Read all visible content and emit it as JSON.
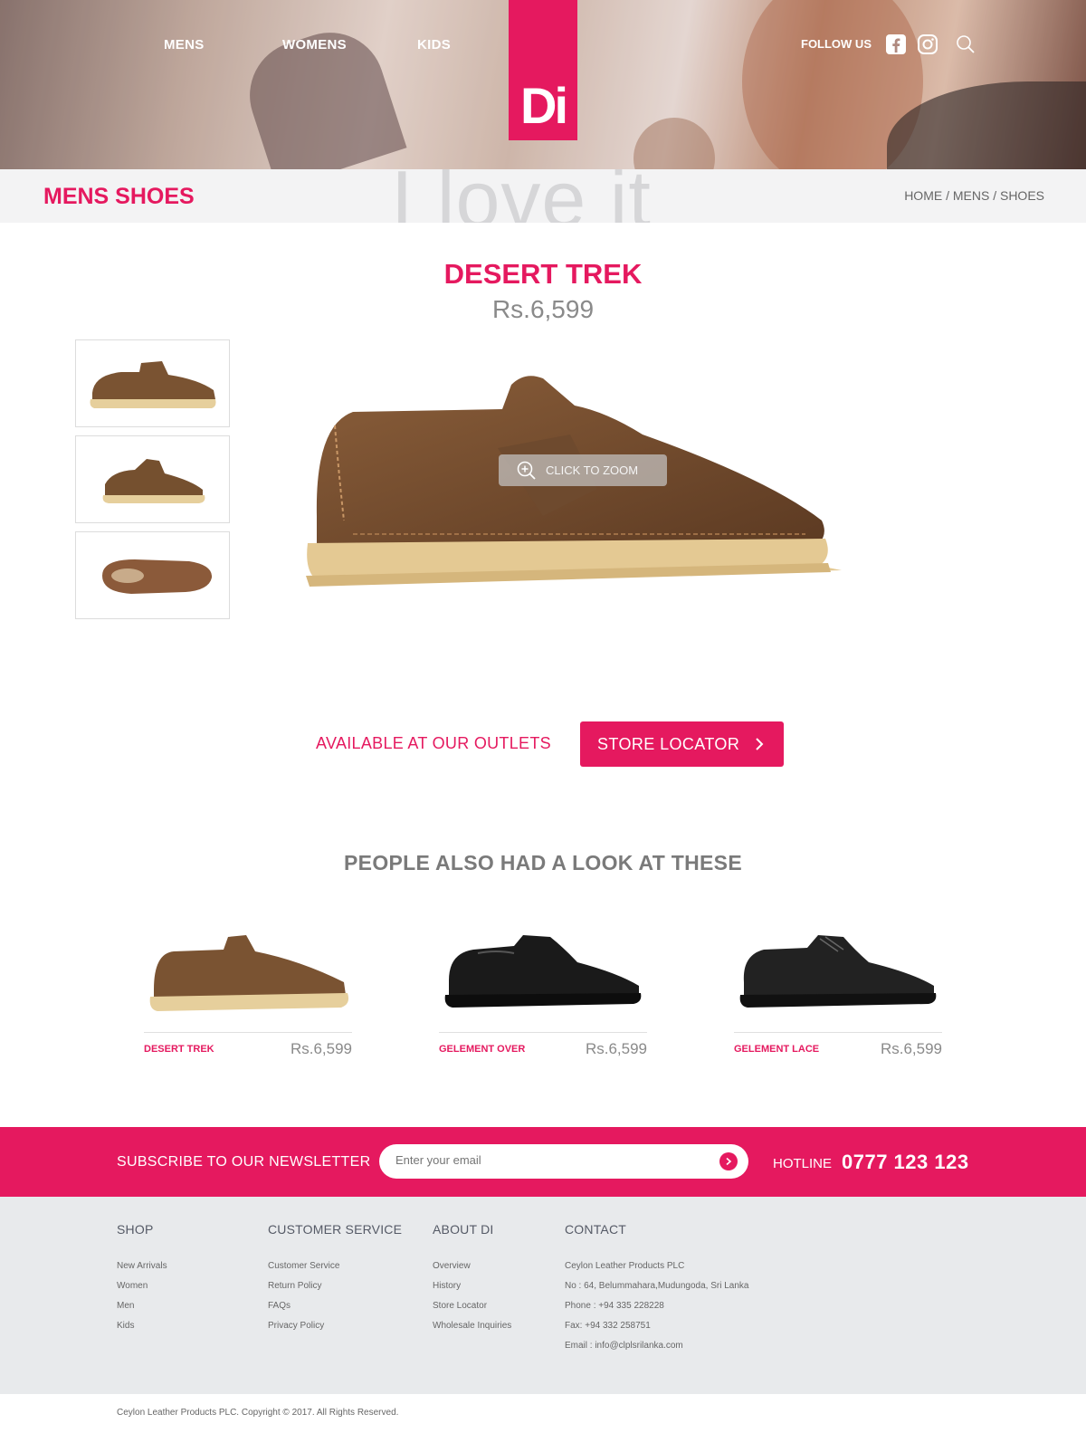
{
  "nav": {
    "mens": "MENS",
    "womens": "WOMENS",
    "kids": "KIDS"
  },
  "logo": "Di",
  "follow": "FOLLOW US",
  "icons": {
    "facebook": "facebook-icon",
    "instagram": "instagram-icon",
    "search": "search-icon"
  },
  "titlebar": {
    "watermark": "I love it",
    "title": "MENS SHOES",
    "breadcrumb": [
      "HOME",
      "MENS",
      "SHOES"
    ],
    "separator": " / "
  },
  "product": {
    "name": "DESERT TREK",
    "price": "Rs.6,599",
    "zoom_label": "CLICK TO ZOOM"
  },
  "outlets": {
    "label": "AVAILABLE AT OUR OUTLETS",
    "button": "STORE LOCATOR"
  },
  "related": {
    "title": "PEOPLE ALSO HAD A LOOK AT THESE",
    "items": [
      {
        "name": "DESERT TREK",
        "price": "Rs.6,599"
      },
      {
        "name": "GELEMENT OVER",
        "price": "Rs.6,599"
      },
      {
        "name": "GELEMENT LACE",
        "price": "Rs.6,599"
      }
    ]
  },
  "newsletter": {
    "label": "SUBSCRIBE TO OUR NEWSLETTER",
    "placeholder": "Enter your email",
    "hotline_label": "HOTLINE",
    "hotline_number": "0777 123 123"
  },
  "footer": {
    "shop": {
      "title": "SHOP",
      "links": [
        "New Arrivals",
        "Women",
        "Men",
        "Kids"
      ]
    },
    "service": {
      "title": "CUSTOMER SERVICE",
      "links": [
        "Customer Service",
        "Return Policy",
        "FAQs",
        "Privacy Policy"
      ]
    },
    "about": {
      "title": "ABOUT DI",
      "links": [
        "Overview",
        "History",
        "Store Locator",
        "Wholesale Inquiries"
      ]
    },
    "contact": {
      "title": "CONTACT",
      "lines": [
        "Ceylon Leather Products PLC",
        "No : 64, Belummahara,Mudungoda, Sri Lanka",
        "Phone : +94 335 228228",
        "Fax: +94 332 258751",
        "Email : info@clplsrilanka.com"
      ]
    }
  },
  "copyright": "Ceylon Leather Products PLC. Copyright © 2017. All Rights Reserved.",
  "colors": {
    "brand": "#e5195f",
    "footer_bg": "#e8eaec",
    "titlebar_bg": "#f3f3f4"
  }
}
